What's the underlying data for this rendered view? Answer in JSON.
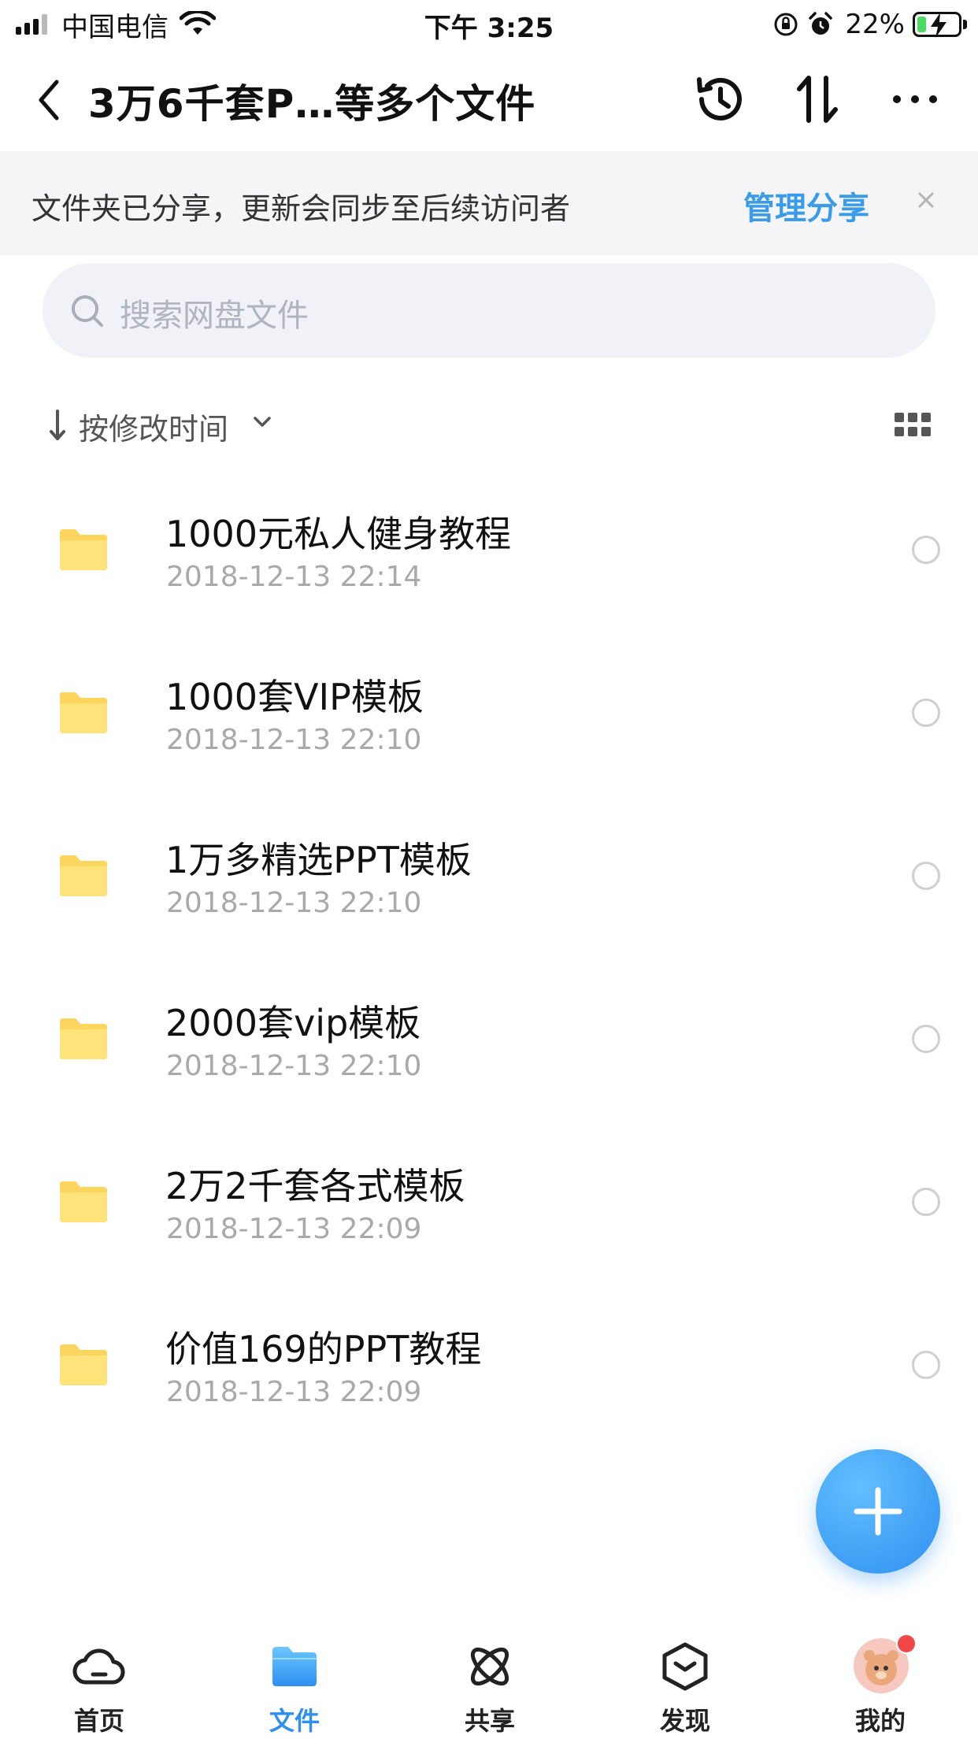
{
  "status_bar": {
    "carrier": "中国电信",
    "time": "下午 3:25",
    "battery_percent": "22%",
    "battery_level": 0.22,
    "icons": [
      "signal-icon",
      "wifi-icon",
      "orientation-lock-icon",
      "alarm-icon",
      "battery-icon"
    ]
  },
  "nav": {
    "title": "3万6千套P…等多个文件",
    "icons": [
      "back-icon",
      "history-icon",
      "transfer-icon",
      "more-icon"
    ]
  },
  "share_banner": {
    "text": "文件夹已分享，更新会同步至后续访问者",
    "manage_label": "管理分享",
    "close_icon": "close-icon",
    "accent_color": "#3a9ce8"
  },
  "search": {
    "placeholder": "搜索网盘文件"
  },
  "sort": {
    "label": "按修改时间",
    "view_icon": "grid-view-icon"
  },
  "files": [
    {
      "name": "1000元私人健身教程",
      "date": "2018-12-13 22:14"
    },
    {
      "name": "1000套VIP模板",
      "date": "2018-12-13 22:10"
    },
    {
      "name": "1万多精选PPT模板",
      "date": "2018-12-13 22:10"
    },
    {
      "name": "2000套vip模板",
      "date": "2018-12-13 22:10"
    },
    {
      "name": "2万2千套各式模板",
      "date": "2018-12-13 22:09"
    },
    {
      "name": "价值169的PPT教程",
      "date": "2018-12-13 22:09"
    }
  ],
  "fab": {
    "icon": "plus-icon"
  },
  "tab_bar": {
    "active": "文件",
    "active_color": "#2f8ff0",
    "tabs": [
      {
        "label": "首页",
        "icon": "cloud-home-icon"
      },
      {
        "label": "文件",
        "icon": "folder-icon"
      },
      {
        "label": "共享",
        "icon": "share-atom-icon"
      },
      {
        "label": "发现",
        "icon": "discover-box-icon"
      },
      {
        "label": "我的",
        "icon": "avatar-icon"
      }
    ]
  }
}
